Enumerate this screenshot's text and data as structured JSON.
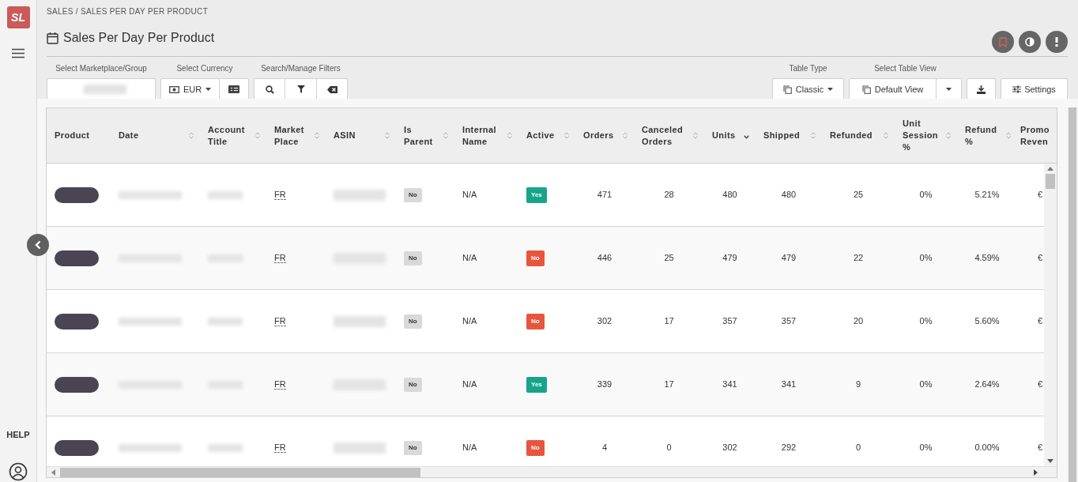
{
  "sidebar": {
    "logo": "SL",
    "help": "HELP"
  },
  "breadcrumb": "SALES / SALES PER DAY PER PRODUCT",
  "page_title": "Sales Per Day Per Product",
  "filters": {
    "marketplace_label": "Select Marketplace/Group",
    "currency_label": "Select Currency",
    "currency": "EUR",
    "search_label": "Search/Manage Filters",
    "table_type_label": "Table Type",
    "table_type": "Classic",
    "table_view_label": "Select Table View",
    "table_view": "Default View",
    "settings": "Settings"
  },
  "table": {
    "columns": [
      {
        "label": "Product",
        "sortable": false
      },
      {
        "label": "Date",
        "sortable": true,
        "sorted_descending": false
      },
      {
        "label": "Account Title",
        "sortable": true,
        "sorted_descending": false
      },
      {
        "label": "Market Place",
        "sortable": true,
        "sorted_descending": false
      },
      {
        "label": "ASIN",
        "sortable": true,
        "sorted_descending": false
      },
      {
        "label": "Is Parent",
        "sortable": true,
        "sorted_descending": false
      },
      {
        "label": "Internal Name",
        "sortable": true,
        "sorted_descending": false
      },
      {
        "label": "Active",
        "sortable": true,
        "sorted_descending": false
      },
      {
        "label": "Orders",
        "sortable": true,
        "sorted_descending": false
      },
      {
        "label": "Canceled Orders",
        "sortable": true,
        "sorted_descending": false
      },
      {
        "label": "Units",
        "sortable": true,
        "sorted_descending": true
      },
      {
        "label": "Shipped",
        "sortable": true,
        "sorted_descending": false
      },
      {
        "label": "Refunded",
        "sortable": true,
        "sorted_descending": false
      },
      {
        "label": "Unit Session %",
        "sortable": true,
        "sorted_descending": false
      },
      {
        "label": "Refund %",
        "sortable": true,
        "sorted_descending": false
      },
      {
        "label": "Promo Reven",
        "sortable": false
      }
    ],
    "rows": [
      {
        "marketplace": "FR",
        "is_parent": "No",
        "internal_name": "N/A",
        "active": "Yes",
        "active_on": true,
        "orders": "471",
        "canceled": "28",
        "units": "480",
        "shipped": "480",
        "refunded": "25",
        "unit_session": "0%",
        "refund_pct": "5.21%",
        "promo": "€"
      },
      {
        "marketplace": "FR",
        "is_parent": "No",
        "internal_name": "N/A",
        "active": "No",
        "active_on": false,
        "orders": "446",
        "canceled": "25",
        "units": "479",
        "shipped": "479",
        "refunded": "22",
        "unit_session": "0%",
        "refund_pct": "4.59%",
        "promo": "€"
      },
      {
        "marketplace": "FR",
        "is_parent": "No",
        "internal_name": "N/A",
        "active": "No",
        "active_on": false,
        "orders": "302",
        "canceled": "17",
        "units": "357",
        "shipped": "357",
        "refunded": "20",
        "unit_session": "0%",
        "refund_pct": "5.60%",
        "promo": "€"
      },
      {
        "marketplace": "FR",
        "is_parent": "No",
        "internal_name": "N/A",
        "active": "Yes",
        "active_on": true,
        "orders": "339",
        "canceled": "17",
        "units": "341",
        "shipped": "341",
        "refunded": "9",
        "unit_session": "0%",
        "refund_pct": "2.64%",
        "promo": "€"
      },
      {
        "marketplace": "FR",
        "is_parent": "No",
        "internal_name": "N/A",
        "active": "No",
        "active_on": false,
        "orders": "4",
        "canceled": "0",
        "units": "302",
        "shipped": "292",
        "refunded": "0",
        "unit_session": "0%",
        "refund_pct": "0.00%",
        "promo": "€"
      }
    ]
  }
}
